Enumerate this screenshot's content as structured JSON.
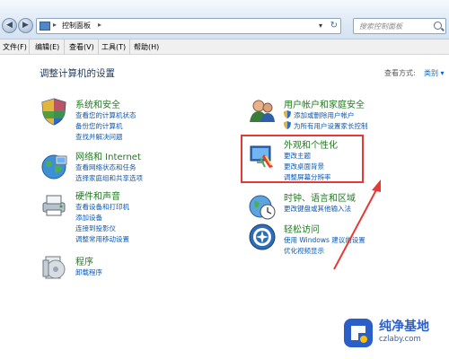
{
  "address": {
    "path": "控制面板",
    "search_placeholder": "搜索控制面板"
  },
  "menu": {
    "items": [
      "文件(F)",
      "编辑(E)",
      "查看(V)",
      "工具(T)",
      "帮助(H)"
    ]
  },
  "page": {
    "title": "调整计算机的设置",
    "viewby_label": "查看方式:",
    "viewby_value": "类别 ▾"
  },
  "categories": {
    "system": {
      "title": "系统和安全",
      "links": [
        "查看您的计算机状态",
        "备份您的计算机",
        "查找并解决问题"
      ]
    },
    "network": {
      "title": "网络和 Internet",
      "links": [
        "查看网络状态和任务",
        "选择家庭组和共享选项"
      ]
    },
    "hardware": {
      "title": "硬件和声音",
      "links": [
        "查看设备和打印机",
        "添加设备",
        "连接到投影仪",
        "调整常用移动设置"
      ]
    },
    "programs": {
      "title": "程序",
      "links": [
        "卸载程序"
      ]
    },
    "users": {
      "title": "用户帐户和家庭安全",
      "links": [
        "添加或删除用户帐户",
        "为所有用户设置家长控制"
      ]
    },
    "appearance": {
      "title": "外观和个性化",
      "links": [
        "更改主题",
        "更改桌面背景",
        "调整屏幕分辨率"
      ]
    },
    "clock": {
      "title": "时钟、语言和区域",
      "links": [
        "更改键盘或其他输入法"
      ]
    },
    "ease": {
      "title": "轻松访问",
      "links": [
        "使用 Windows 建议的设置",
        "优化视频显示"
      ]
    }
  },
  "watermark": {
    "brand": "纯净基地",
    "url": "czlaby.com"
  },
  "colors": {
    "category_title": "#1f7a1f",
    "link": "#0b59b3",
    "highlight": "#e53935",
    "watermark": "#2b5ec8"
  }
}
